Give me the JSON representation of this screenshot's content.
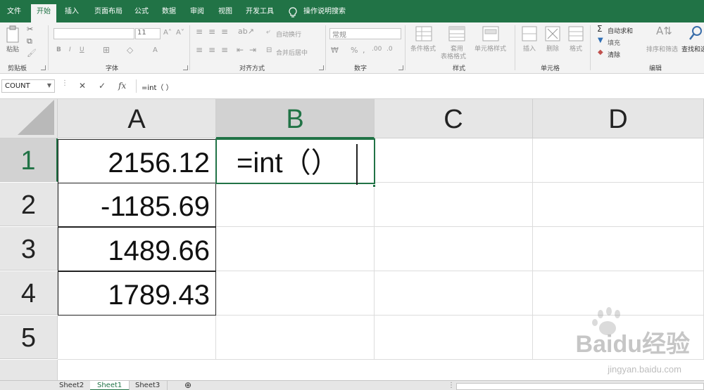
{
  "tabs": [
    {
      "label": "文件",
      "active": false
    },
    {
      "label": "开始",
      "active": true
    },
    {
      "label": "插入",
      "active": false
    },
    {
      "label": "页面布局",
      "active": false
    },
    {
      "label": "公式",
      "active": false
    },
    {
      "label": "数据",
      "active": false
    },
    {
      "label": "审阅",
      "active": false
    },
    {
      "label": "视图",
      "active": false
    },
    {
      "label": "开发工具",
      "active": false
    }
  ],
  "tell_me": "操作说明搜索",
  "ribbon": {
    "clipboard": {
      "paste": "粘贴",
      "group": "剪贴板"
    },
    "font": {
      "size": "11",
      "group": "字体"
    },
    "alignment": {
      "wrap": "自动换行",
      "merge": "合并后居中",
      "group": "对齐方式"
    },
    "number": {
      "format": "常规",
      "group": "数字"
    },
    "styles": {
      "conditional": "条件格式",
      "table_format_1": "套用",
      "table_format_2": "表格格式",
      "cell_styles": "单元格样式",
      "group": "样式"
    },
    "cells": {
      "insert": "插入",
      "delete": "删除",
      "format": "格式",
      "group": "单元格"
    },
    "editing": {
      "autosum": "自动求和",
      "fill": "填充",
      "clear": "清除",
      "sort": "排序和筛选",
      "find": "查找和选",
      "group": "编辑"
    }
  },
  "formula_bar": {
    "name_box": "COUNT",
    "formula": "=int（ ）"
  },
  "columns": [
    "A",
    "B",
    "C",
    "D"
  ],
  "rows": [
    "1",
    "2",
    "3",
    "4",
    "5"
  ],
  "cells": {
    "A1": "2156.12",
    "A2": "-1185.69",
    "A3": "1489.66",
    "A4": "1789.43",
    "B1": "=int（）"
  },
  "sheets": [
    {
      "label": "Sheet2",
      "active": false
    },
    {
      "label": "Sheet1",
      "active": true
    },
    {
      "label": "Sheet3",
      "active": false
    }
  ],
  "watermark": {
    "brand": "Baidu经验",
    "url": "jingyan.baidu.com"
  },
  "colors": {
    "accent": "#217346"
  }
}
